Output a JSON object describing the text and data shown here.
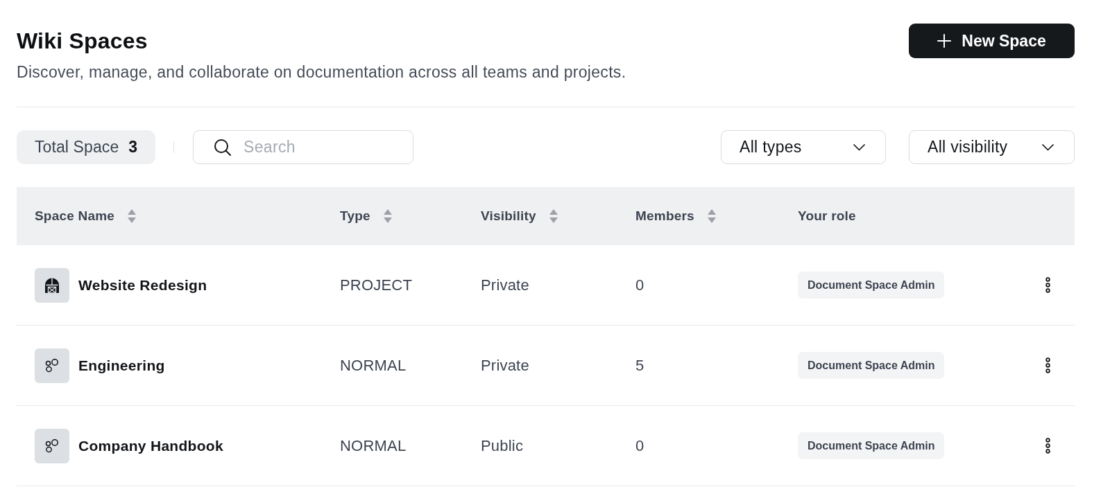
{
  "header": {
    "title": "Wiki Spaces",
    "subtitle": "Discover, manage, and collaborate on documentation across all teams and projects.",
    "action": {
      "label": "New Space"
    }
  },
  "toolbar": {
    "total": {
      "label": "Total Space",
      "count": "3"
    },
    "search": {
      "placeholder": "Search"
    },
    "filters": [
      {
        "value": "All types"
      },
      {
        "value": "All visibility"
      }
    ]
  },
  "table": {
    "columns": [
      {
        "label": "Space Name",
        "sortable": true
      },
      {
        "label": "Type",
        "sortable": true
      },
      {
        "label": "Visibility",
        "sortable": true
      },
      {
        "label": "Members",
        "sortable": true
      },
      {
        "label": "Your role",
        "sortable": false
      }
    ],
    "rows": [
      {
        "kind": "project",
        "name": "Website Redesign",
        "type": "PROJECT",
        "visibility": "Private",
        "members": "0",
        "role": "Document Space Admin"
      },
      {
        "kind": "normal",
        "name": "Engineering",
        "type": "NORMAL",
        "visibility": "Private",
        "members": "5",
        "role": "Document Space Admin"
      },
      {
        "kind": "normal",
        "name": "Company Handbook",
        "type": "NORMAL",
        "visibility": "Public",
        "members": "0",
        "role": "Document Space Admin"
      }
    ]
  }
}
